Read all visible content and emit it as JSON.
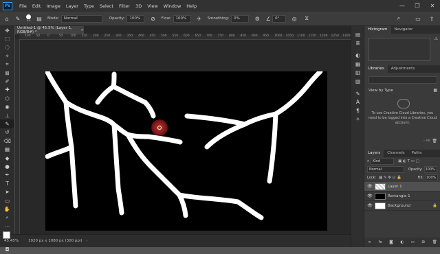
{
  "menubar": {
    "logo": "Ps",
    "items": [
      "File",
      "Edit",
      "Image",
      "Layer",
      "Type",
      "Select",
      "Filter",
      "3D",
      "View",
      "Window",
      "Help"
    ],
    "window_controls": [
      "—",
      "❐",
      "✕"
    ]
  },
  "options": {
    "mode_label": "Mode:",
    "mode_value": "Normal",
    "opacity_label": "Opacity:",
    "opacity_value": "100%",
    "flow_label": "Flow:",
    "flow_value": "100%",
    "smoothing_label": "Smoothing:",
    "smoothing_value": "0%",
    "angle_value": "0°",
    "brush_size": "13"
  },
  "document": {
    "tab_title": "Untitled-1 @ 45.5% (Layer 1, RGB/8#) *",
    "ruler_ticks": [
      "100",
      "50",
      "0",
      "50",
      "100",
      "150",
      "200",
      "250",
      "300",
      "350",
      "400",
      "450",
      "500",
      "550",
      "600",
      "650",
      "700",
      "750",
      "800",
      "850",
      "900",
      "950",
      "1000",
      "1050",
      "1100",
      "1150",
      "1200",
      "1250",
      "1300"
    ]
  },
  "status": {
    "zoom": "45.45%",
    "doc_size": "1920 px x 1080 px (300 ppi)"
  },
  "panels": {
    "top_tabs": [
      "Histogram",
      "Navigator"
    ],
    "libraries_tabs": [
      "Libraries",
      "Adjustments"
    ],
    "view_by": "View by Type",
    "cc_message": "To use Creative Cloud Libraries, you need to be logged into a Creative Cloud account.",
    "size_note": "-- KB",
    "layers_tabs": [
      "Layers",
      "Channels",
      "Paths"
    ],
    "kind_label": "Kind",
    "blend_mode": "Normal",
    "opacity_label": "Opacity:",
    "opacity_value": "100%",
    "lock_label": "Lock:",
    "fill_label": "Fill:",
    "fill_value": "100%",
    "layers": [
      {
        "name": "Layer 1",
        "selected": true
      },
      {
        "name": "Rectangle 1",
        "selected": false
      },
      {
        "name": "Background",
        "selected": false
      }
    ]
  },
  "colors": {
    "accent": "#31a8ff",
    "cursor": "#e03c3c",
    "canvas": "#000000",
    "stroke": "#ffffff"
  }
}
